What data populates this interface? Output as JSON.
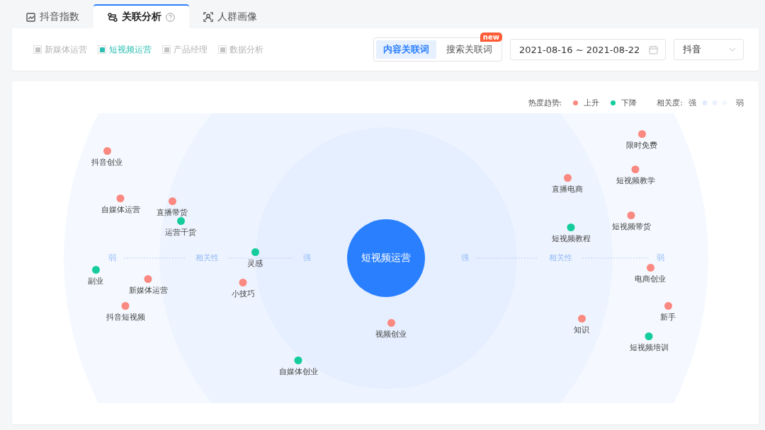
{
  "tabs": [
    {
      "label": "抖音指数",
      "selected": false
    },
    {
      "label": "关联分析",
      "selected": true,
      "help": true
    },
    {
      "label": "人群画像",
      "selected": false
    }
  ],
  "filters": [
    {
      "label": "新媒体运营",
      "checked": false
    },
    {
      "label": "短视频运营",
      "checked": true
    },
    {
      "label": "产品经理",
      "checked": false
    },
    {
      "label": "数据分析",
      "checked": false
    }
  ],
  "mode_toggle": [
    {
      "label": "内容关联词",
      "selected": true
    },
    {
      "label": "搜索关联词",
      "selected": false,
      "badge": "new"
    }
  ],
  "date_range": {
    "value": "2021-08-16 ~ 2021-08-22"
  },
  "platform_select": {
    "value": "抖音"
  },
  "legend": {
    "trend_title": "热度趋势:",
    "trends": [
      {
        "label": "上升",
        "color": "#f98981"
      },
      {
        "label": "下降",
        "color": "#14cc9c"
      }
    ],
    "relevance_title": "相关度:",
    "strong": "强",
    "weak": "弱"
  },
  "center_node": {
    "label": "短视频运营"
  },
  "axis": {
    "left": [
      "弱",
      "相关性",
      "强"
    ],
    "right": [
      "强",
      "相关性",
      "弱"
    ]
  },
  "nodes": [
    {
      "label": "抖音创业",
      "color": "#f98981"
    },
    {
      "label": "自媒体运营",
      "color": "#f98981"
    },
    {
      "label": "直播带货",
      "color": "#f98981"
    },
    {
      "label": "运营干货",
      "color": "#14cc9c"
    },
    {
      "label": "灵感",
      "color": "#14cc9c"
    },
    {
      "label": "副业",
      "color": "#14cc9c"
    },
    {
      "label": "新媒体运营",
      "color": "#f98981"
    },
    {
      "label": "小技巧",
      "color": "#f98981"
    },
    {
      "label": "抖音短视频",
      "color": "#f98981"
    },
    {
      "label": "自媒体创业",
      "color": "#14cc9c"
    },
    {
      "label": "视频创业",
      "color": "#f98981"
    },
    {
      "label": "直播电商",
      "color": "#f98981"
    },
    {
      "label": "短视频教程",
      "color": "#14cc9c"
    },
    {
      "label": "限时免费",
      "color": "#f98981"
    },
    {
      "label": "短视频教学",
      "color": "#f98981"
    },
    {
      "label": "短视频带货",
      "color": "#f98981"
    },
    {
      "label": "电商创业",
      "color": "#f98981"
    },
    {
      "label": "新手",
      "color": "#f98981"
    },
    {
      "label": "知识",
      "color": "#f98981"
    },
    {
      "label": "短视频培训",
      "color": "#14cc9c"
    }
  ]
}
